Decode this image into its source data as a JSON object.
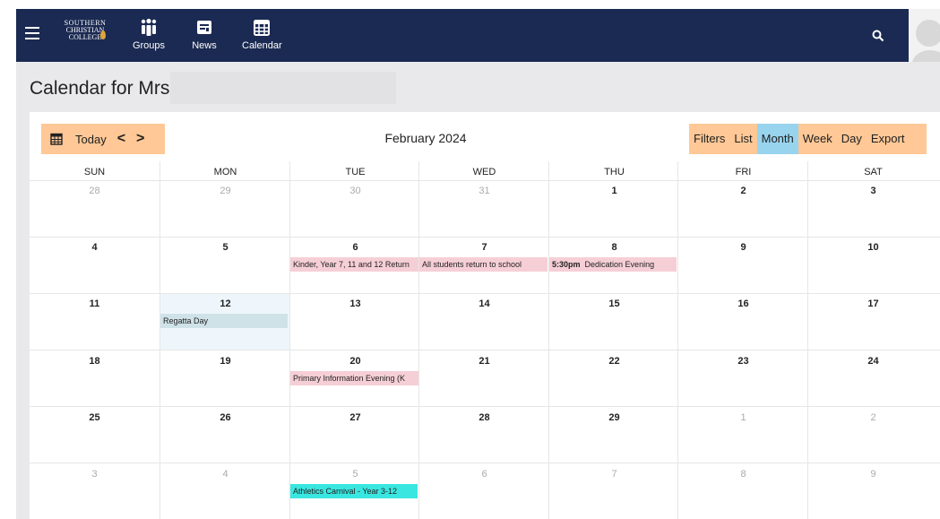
{
  "nav": {
    "logo_line1": "SOUTHERN",
    "logo_line2": "CHRISTIAN",
    "logo_line3": "COLLEGE",
    "items": [
      {
        "label": "Groups",
        "icon": "groups-icon"
      },
      {
        "label": "News",
        "icon": "news-icon"
      },
      {
        "label": "Calendar",
        "icon": "calendar-icon"
      }
    ]
  },
  "page": {
    "title": "Calendar for Mrs"
  },
  "toolbar": {
    "today": "Today",
    "prev": "<",
    "next": ">",
    "month_title": "February 2024",
    "views": [
      "Filters",
      "List",
      "Month",
      "Week",
      "Day",
      "Export"
    ],
    "active_view": "Month"
  },
  "calendar": {
    "weekdays": [
      "SUN",
      "MON",
      "TUE",
      "WED",
      "THU",
      "FRI",
      "SAT"
    ],
    "weeks": [
      [
        "28",
        "29",
        "30",
        "31",
        "1",
        "2",
        "3"
      ],
      [
        "4",
        "5",
        "6",
        "7",
        "8",
        "9",
        "10"
      ],
      [
        "11",
        "12",
        "13",
        "14",
        "15",
        "16",
        "17"
      ],
      [
        "18",
        "19",
        "20",
        "21",
        "22",
        "23",
        "24"
      ],
      [
        "25",
        "26",
        "27",
        "28",
        "29",
        "1",
        "2"
      ],
      [
        "3",
        "4",
        "5",
        "6",
        "7",
        "8",
        "9"
      ]
    ],
    "events": [
      {
        "text": "Kinder, Year 7, 11 and 12 Return"
      },
      {
        "text": "All students return to school"
      },
      {
        "time": "5:30pm",
        "text": "Dedication Evening"
      },
      {
        "text": "Regatta Day"
      },
      {
        "text": "Primary Information Evening (K"
      },
      {
        "text": "Athletics Carnival - Year 3-12"
      }
    ]
  },
  "colors": {
    "nav_bg": "#1b2a52",
    "toolbar_btn": "#ffc896",
    "active_view": "#98d4ee",
    "event_pink": "#f6cfd6",
    "event_teal": "#cfe2e8",
    "event_cyan": "#39e7e0"
  }
}
